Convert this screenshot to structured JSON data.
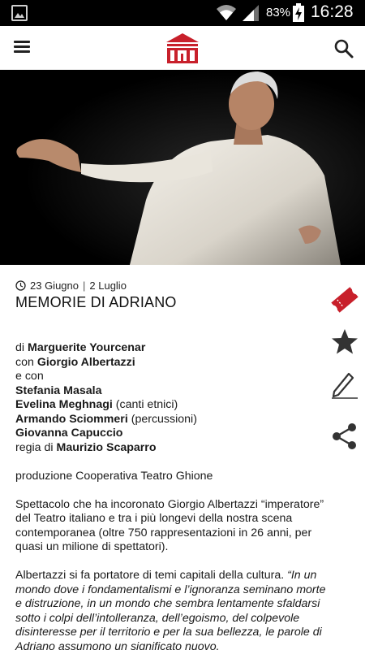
{
  "status_bar": {
    "battery_text": "83%",
    "time": "16:28"
  },
  "app_bar": {
    "menu_icon": "hamburger-menu-icon",
    "logo_icon": "theatre-logo-icon",
    "search_icon": "search-icon"
  },
  "event": {
    "date_start": "23 Giugno",
    "date_separator": "|",
    "date_end": "2 Luglio",
    "title": "MEMORIE DI ADRIANO"
  },
  "credits": {
    "author_prefix": "di",
    "author": "Marguerite Yourcenar",
    "lead_prefix": "con",
    "lead": "Giorgio Albertazzi",
    "with_prefix": "e con",
    "cast": [
      {
        "name": "Stefania Masala",
        "role": ""
      },
      {
        "name": "Evelina Meghnagi",
        "role": "(canti etnici)"
      },
      {
        "name": "Armando Sciommeri",
        "role": "(percussioni)"
      },
      {
        "name": "Giovanna Capuccio",
        "role": ""
      }
    ],
    "director_prefix": "regia di",
    "director": "Maurizio Scaparro",
    "production": "produzione Cooperativa Teatro Ghione"
  },
  "description": {
    "paragraph1": "Spettacolo che ha incoronato Giorgio Albertazzi “imperatore” del Teatro italiano e tra i più longevi della nostra scena contemporanea (oltre 750 rappresentazioni in 26 anni, per quasi un milione di spettatori).",
    "paragraph2_plain": "Albertazzi si fa portatore di temi capitali della cultura. ",
    "paragraph2_italic": "“In un mondo dove i fondamentalismi e l’ignoranza seminano morte e distruzione, in un mondo che sembra lentamente sfaldarsi sotto i colpi dell’intolleranza, dell’egoismo, del colpevole disinteresse per il territorio e per la sua bellezza, le parole di Adriano assumono un significato nuovo."
  },
  "actions": {
    "ticket_icon": "ticket-icon",
    "favorite_icon": "star-icon",
    "review_icon": "pencil-icon",
    "share_icon": "share-icon"
  },
  "colors": {
    "accent": "#c8202b",
    "icon_dark": "#333333",
    "status_bar_bg": "#000000"
  }
}
